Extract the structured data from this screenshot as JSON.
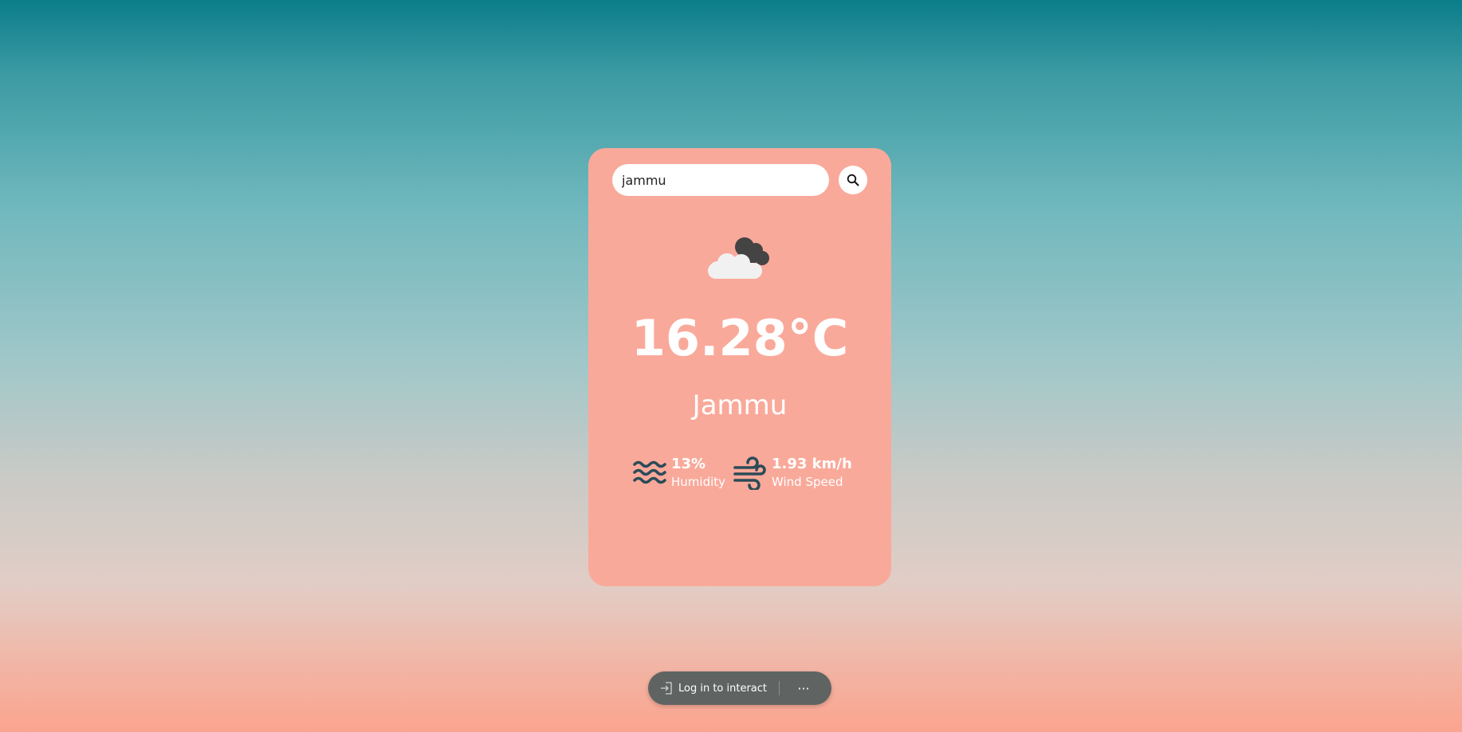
{
  "search": {
    "value": "jammu"
  },
  "weather": {
    "icon": "cloud-icon",
    "temperature": "16.28°C",
    "city": "Jammu"
  },
  "details": {
    "humidity": {
      "value": "13%",
      "label": "Humidity",
      "icon": "humidity-waves-icon"
    },
    "wind": {
      "value": "1.93 km/h",
      "label": "Wind Speed",
      "icon": "wind-icon"
    }
  },
  "overlay": {
    "login_label": "Log in to interact",
    "more_label": "···"
  },
  "colors": {
    "card": "#f9a99a",
    "icon_dark": "#2b4b58",
    "pill": "#5f6463"
  }
}
